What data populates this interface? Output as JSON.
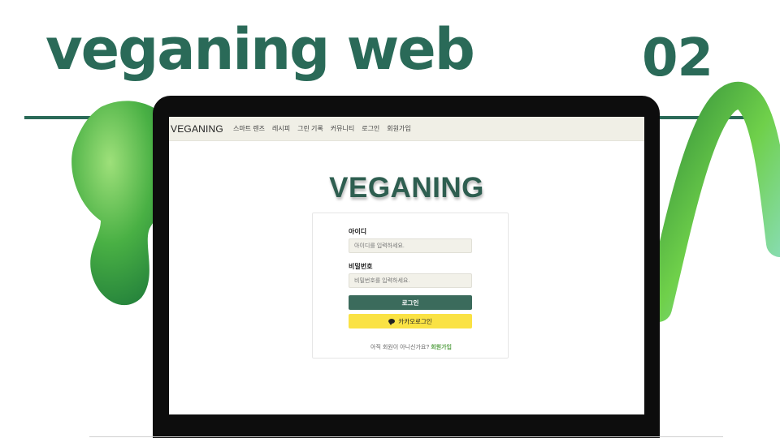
{
  "slide": {
    "title": "veganing web",
    "number": "02"
  },
  "site": {
    "logo": "VEGANING",
    "nav": [
      "스마트 렌즈",
      "레시피",
      "그린 기록",
      "커뮤니티",
      "로그인",
      "회원가입"
    ]
  },
  "login": {
    "brand": "VEGANING",
    "id_label": "아이디",
    "id_placeholder": "아이디를 입력하세요.",
    "pw_label": "비밀번호",
    "pw_placeholder": "비밀번호를 입력하세요.",
    "login_button": "로그인",
    "kakao_button": "카카오로그인",
    "signup_prompt": "아직 회원이 아니신가요?",
    "signup_link": "회원가입"
  },
  "colors": {
    "brand_green": "#2a6a58",
    "login_button": "#3b6b5c",
    "kakao_yellow": "#fae244",
    "nav_background": "#f0efe6"
  },
  "icons": {
    "kakao": "chat-bubble-icon"
  }
}
